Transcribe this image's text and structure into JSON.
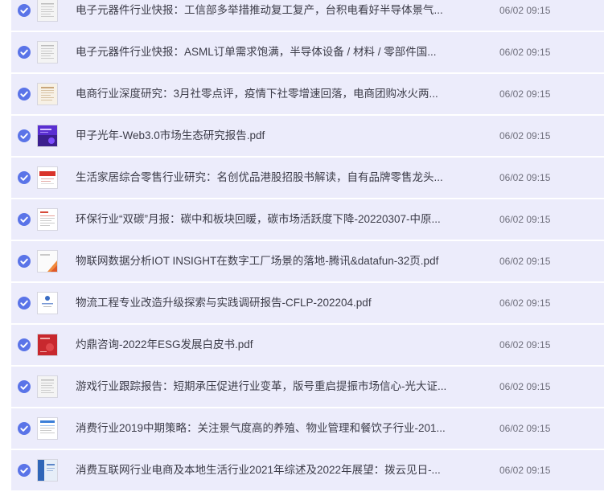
{
  "files": [
    {
      "name": "电子元器件行业快报：工信部多举措推动复工复产，台积电看好半导体景气...",
      "date": "06/02 09:15",
      "selected": true,
      "thumb_icon": "document-gray-icon"
    },
    {
      "name": "电子元器件行业快报：ASML订单需求饱满，半导体设备 / 材料 / 零部件国...",
      "date": "06/02 09:15",
      "selected": true,
      "thumb_icon": "document-gray-icon"
    },
    {
      "name": "电商行业深度研究：3月社零点评，疫情下社零增速回落，电商团购冰火两...",
      "date": "06/02 09:15",
      "selected": true,
      "thumb_icon": "document-tan-icon"
    },
    {
      "name": "甲子光年-Web3.0市场生态研究报告.pdf",
      "date": "06/02 09:15",
      "selected": true,
      "thumb_icon": "document-purple-cover-icon"
    },
    {
      "name": "生活家居综合零售行业研究：名创优品港股招股书解读，自有品牌零售龙头...",
      "date": "06/02 09:15",
      "selected": true,
      "thumb_icon": "document-red-banner-icon"
    },
    {
      "name": "环保行业“双碳”月报：碳中和板块回暖，碳市场活跃度下降-20220307-中原...",
      "date": "06/02 09:15",
      "selected": true,
      "thumb_icon": "document-red-header-icon"
    },
    {
      "name": "物联网数据分析IOT INSIGHT在数字工厂场景的落地-腾讯&datafun-32页.pdf",
      "date": "06/02 09:15",
      "selected": true,
      "thumb_icon": "document-orange-cover-icon"
    },
    {
      "name": "物流工程专业改造升级探索与实践调研报告-CFLP-202204.pdf",
      "date": "06/02 09:15",
      "selected": true,
      "thumb_icon": "document-blue-logo-icon"
    },
    {
      "name": "灼鼎咨询-2022年ESG发展白皮书.pdf",
      "date": "06/02 09:15",
      "selected": true,
      "thumb_icon": "document-red-cover-icon"
    },
    {
      "name": "游戏行业跟踪报告：短期承压促进行业变革，版号重启提振市场信心-光大证...",
      "date": "06/02 09:15",
      "selected": true,
      "thumb_icon": "document-gray-icon"
    },
    {
      "name": "消费行业2019中期策略：关注景气度高的养殖、物业管理和餐饮子行业-201...",
      "date": "06/02 09:15",
      "selected": true,
      "thumb_icon": "document-blue-lines-icon"
    },
    {
      "name": "消费互联网行业电商及本地生活行业2021年综述及2022年展望：拨云见日-...",
      "date": "06/02 09:15",
      "selected": true,
      "thumb_icon": "document-blue-cover-icon"
    }
  ],
  "colors": {
    "row_background": "#ececfb",
    "check_accent": "#5a74e8",
    "text": "#3c3c48",
    "date_text": "#6f6f7c"
  }
}
